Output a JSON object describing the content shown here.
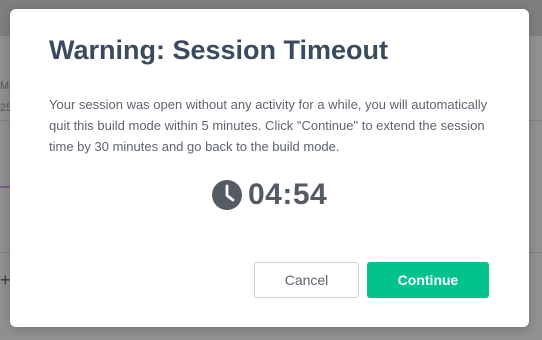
{
  "background": {
    "fragment_text_1": "MC",
    "fragment_text_2": "25",
    "plus_icon": "plus-icon"
  },
  "dialog": {
    "title": "Warning: Session Timeout",
    "message": "Your session was open without any activity for a while, you will automatically quit this build mode within 5 minutes. Click \"Continue\" to extend the session time by 30 minutes and go back to the build mode.",
    "timer": {
      "icon": "clock-icon",
      "value": "04:54"
    },
    "buttons": {
      "cancel_label": "Cancel",
      "continue_label": "Continue"
    }
  },
  "colors": {
    "title": "#3b4a5e",
    "body_text": "#5e6470",
    "continue_bg": "#02c38e",
    "overlay": "#8c8c8c"
  }
}
